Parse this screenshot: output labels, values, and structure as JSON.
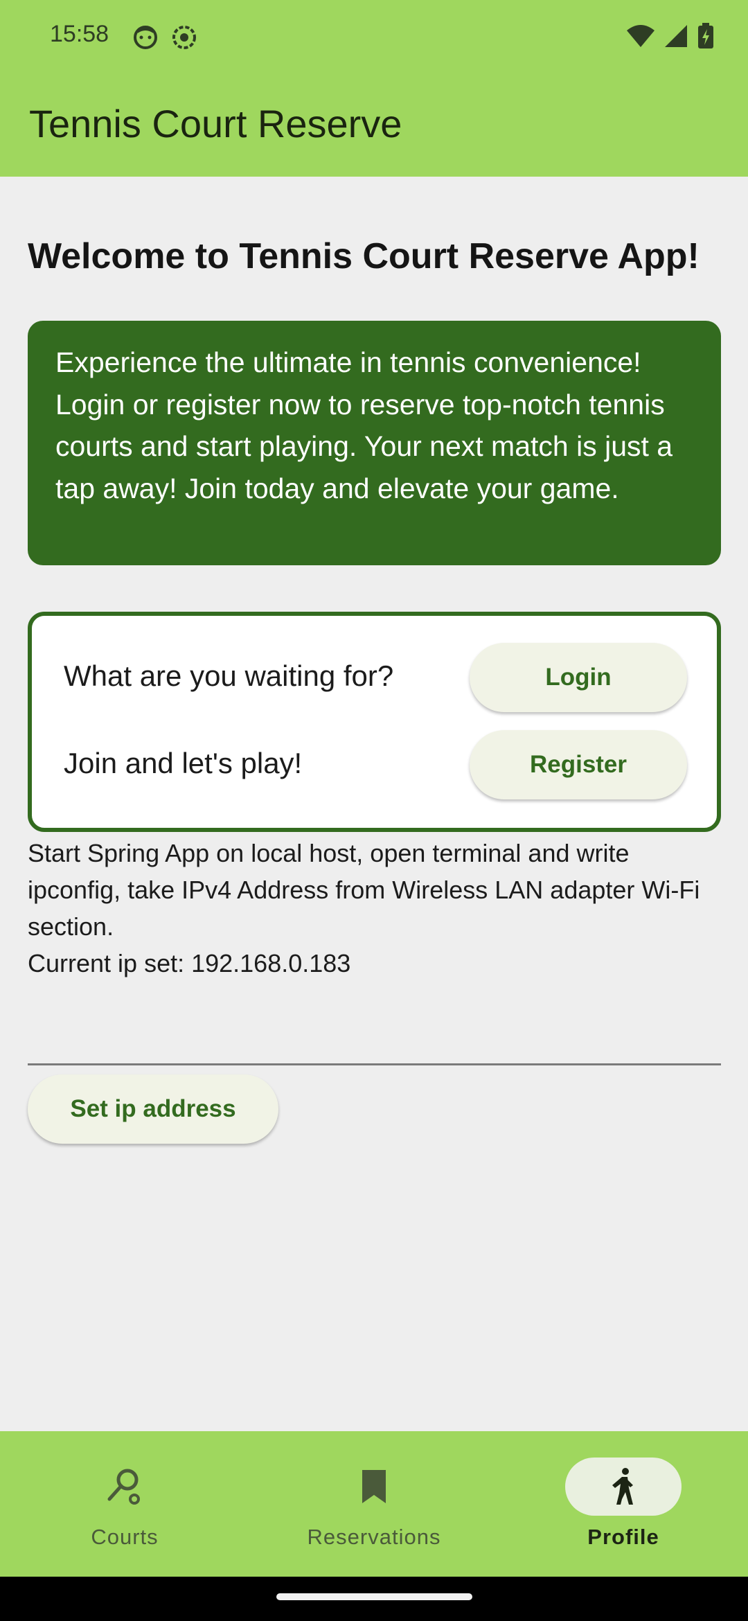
{
  "status": {
    "time": "15:58"
  },
  "appbar": {
    "title": "Tennis Court Reserve"
  },
  "welcome": "Welcome to Tennis Court Reserve App!",
  "promo": "Experience the ultimate in tennis convenience! Login or register now to reserve top-notch tennis courts and start playing. Your next match is just a tap away! Join today and elevate your game.",
  "auth": {
    "login_prompt": "What are you waiting for?",
    "login_label": "Login",
    "register_prompt": "Join and let's play!",
    "register_label": "Register"
  },
  "info": {
    "instructions": "Start Spring App on local host, open terminal and write ipconfig, take IPv4 Address from Wireless LAN adapter Wi-Fi section.",
    "current_ip": "Current ip set: 192.168.0.183"
  },
  "ip_input": {
    "value": ""
  },
  "set_ip_label": "Set ip address",
  "bottom_nav": {
    "items": [
      {
        "label": "Courts",
        "icon": "search-icon",
        "active": false
      },
      {
        "label": "Reservations",
        "icon": "bookmark-icon",
        "active": false
      },
      {
        "label": "Profile",
        "icon": "walking-person-icon",
        "active": true
      }
    ]
  },
  "colors": {
    "appbar": "#9fd75e",
    "promo_bg": "#336b1f",
    "button_bg": "#f1f3e6",
    "button_text": "#336b1f",
    "background": "#eeeeee"
  }
}
